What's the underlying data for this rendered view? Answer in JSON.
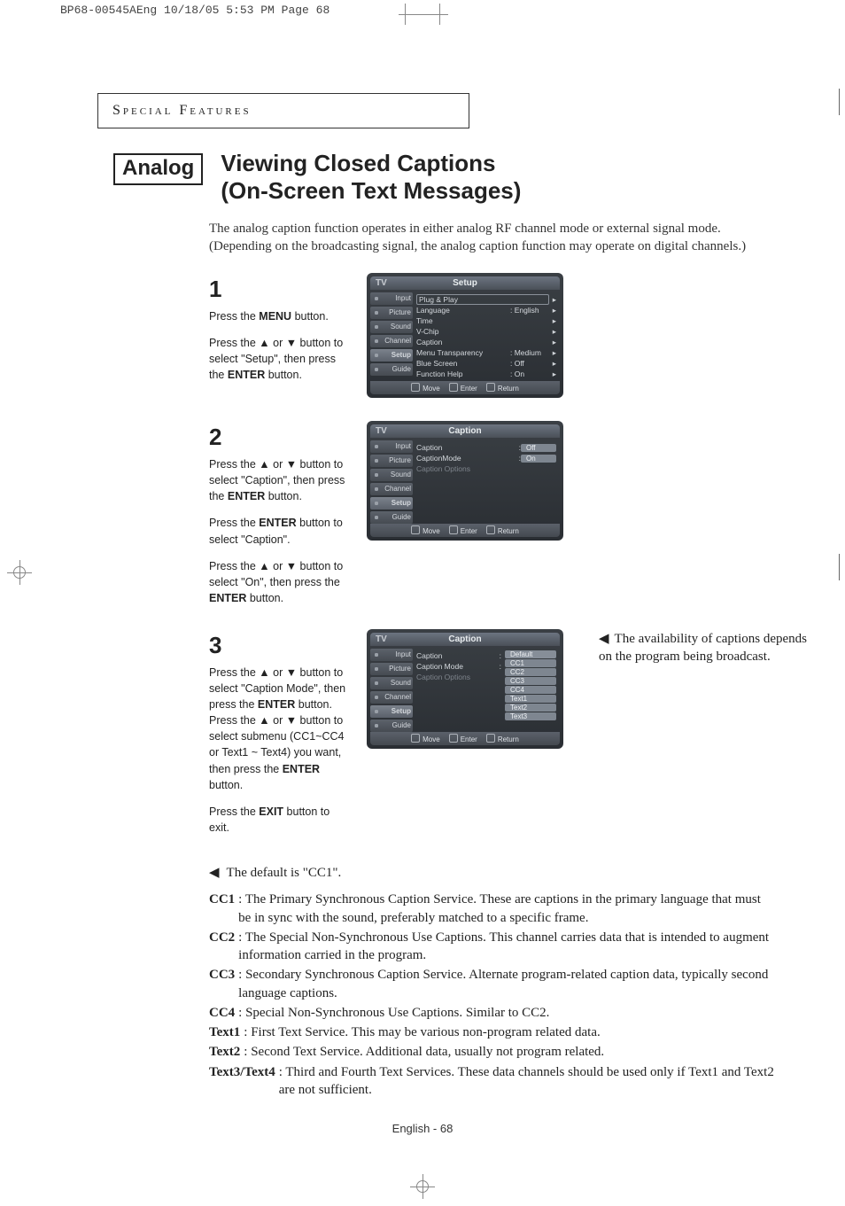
{
  "print_header": "BP68-00545AEng  10/18/05  5:53 PM  Page 68",
  "section_header": "Special Features",
  "badge": "Analog",
  "title_line1": "Viewing Closed Captions",
  "title_line2": "(On-Screen Text Messages)",
  "intro": "The analog caption function operates in either analog RF channel mode or external signal mode. (Depending on the broadcasting signal, the analog caption function may operate on digital channels.)",
  "side_note": "The availability of captions depends on the program being broadcast.",
  "steps": {
    "s1": {
      "num": "1",
      "p1a": "Press the ",
      "p1b": "MENU",
      "p1c": " button.",
      "p2a": "Press the ▲ or ▼ button to select \"Setup\", then press the ",
      "p2b": "ENTER",
      "p2c": " button."
    },
    "s2": {
      "num": "2",
      "p1a": "Press the ▲ or ▼ button to select \"Caption\", then press the ",
      "p1b": "ENTER",
      "p1c": " button.",
      "p2a": "Press the ",
      "p2b": "ENTER",
      "p2c": " button to select \"Caption\".",
      "p3a": "Press the ▲ or ▼ button to select \"On\", then press the ",
      "p3b": "ENTER",
      "p3c": " button."
    },
    "s3": {
      "num": "3",
      "p1a": "Press the ▲ or ▼ button to select \"Caption Mode\", then press the ",
      "p1b": "ENTER",
      "p1c": " button.",
      "p2a": "Press the ▲ or ▼ button to select  submenu (CC1~CC4 or Text1 ~ Text4) you want, then press the ",
      "p2b": "ENTER",
      "p2c": " button.",
      "p3a": "Press the ",
      "p3b": "EXIT",
      "p3c": " button to exit."
    }
  },
  "osd_common": {
    "tv": "TV",
    "tabs": [
      "Input",
      "Picture",
      "Sound",
      "Channel",
      "Setup",
      "Guide"
    ],
    "footer": {
      "move": "Move",
      "enter": "Enter",
      "return": "Return"
    }
  },
  "osd1": {
    "title": "Setup",
    "rows": [
      {
        "k": "Plug & Play",
        "v": "",
        "boxed": true
      },
      {
        "k": "Language",
        "v": ": English"
      },
      {
        "k": "Time",
        "v": ""
      },
      {
        "k": "V-Chip",
        "v": ""
      },
      {
        "k": "Caption",
        "v": ""
      },
      {
        "k": "Menu Transparency",
        "v": ": Medium"
      },
      {
        "k": "Blue Screen",
        "v": ": Off"
      },
      {
        "k": "Function Help",
        "v": ": On"
      }
    ]
  },
  "osd2": {
    "title": "Caption",
    "rows": [
      {
        "k": "Caption",
        "v": "Off",
        "hl": true,
        "colon": ":"
      },
      {
        "k": "CaptionMode",
        "v": "On",
        "hl": true,
        "colon": ":"
      },
      {
        "k": "Caption Options",
        "gray": true
      }
    ]
  },
  "osd3": {
    "title": "Caption",
    "rows": [
      {
        "k": "Caption",
        "colon": ":"
      },
      {
        "k": "Caption Mode",
        "colon": ":"
      },
      {
        "k": "Caption Options",
        "gray": true
      }
    ],
    "options": [
      "Default",
      "CC1",
      "CC2",
      "CC3",
      "CC4",
      "Text1",
      "Text2",
      "Text3"
    ]
  },
  "notes": {
    "lead": "The default is \"CC1\".",
    "items": [
      {
        "k": "CC1",
        "d": ": The Primary Synchronous Caption Service. These are captions in the primary language that must be in sync with the sound, preferably matched to a specific frame."
      },
      {
        "k": "CC2",
        "d": ": The Special Non-Synchronous Use Captions. This channel carries data that is intended to augment information carried in the program."
      },
      {
        "k": "CC3",
        "d": ": Secondary Synchronous Caption Service. Alternate program-related caption data, typically second language captions."
      },
      {
        "k": "CC4",
        "d": ": Special Non-Synchronous Use Captions. Similar to CC2."
      },
      {
        "k": "Text1",
        "d": ": First Text Service. This may be various non-program related data."
      },
      {
        "k": "Text2",
        "d": ": Second Text Service. Additional data, usually not program related."
      },
      {
        "k": "Text3/Text4",
        "d": ": Third and Fourth Text Services. These data channels should be used only if Text1 and Text2 are not sufficient."
      }
    ]
  },
  "footer": {
    "lang": "English",
    "sep": " - ",
    "page": "68"
  }
}
